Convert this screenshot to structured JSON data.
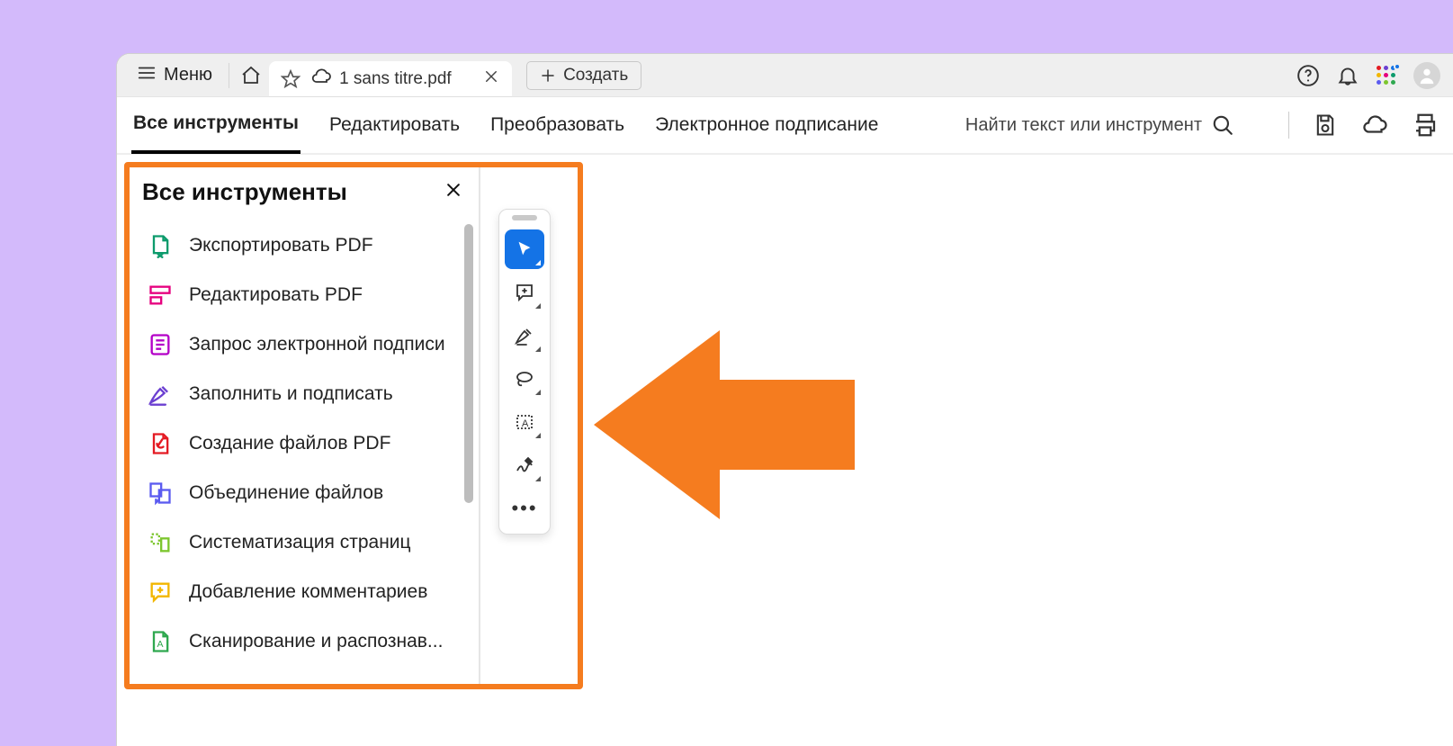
{
  "titlebar": {
    "menu_label": "Меню",
    "tab_title": "1 sans titre.pdf",
    "create_label": "Создать"
  },
  "toolbar": {
    "tabs": [
      "Все инструменты",
      "Редактировать",
      "Преобразовать",
      "Электронное подписание"
    ],
    "search_label": "Найти текст или инструмент"
  },
  "panel": {
    "title": "Все инструменты",
    "tools": [
      {
        "label": "Экспортировать PDF",
        "color": "#0d9b6c"
      },
      {
        "label": "Редактировать PDF",
        "color": "#e6007e"
      },
      {
        "label": "Запрос электронной подписи",
        "color": "#b400c8"
      },
      {
        "label": "Заполнить и подписать",
        "color": "#6b3fd1"
      },
      {
        "label": "Создание файлов PDF",
        "color": "#e41b23"
      },
      {
        "label": "Объединение файлов",
        "color": "#5b5bf0"
      },
      {
        "label": "Систематизация страниц",
        "color": "#7cc62e"
      },
      {
        "label": "Добавление комментариев",
        "color": "#f2b600"
      },
      {
        "label": "Сканирование и распознав...",
        "color": "#2fa84f"
      }
    ]
  },
  "annotation": {
    "highlight_color": "#f57c1f",
    "arrow_color": "#f57c1f"
  }
}
